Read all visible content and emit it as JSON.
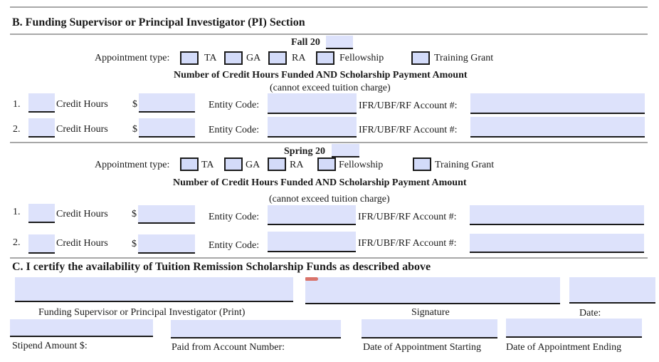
{
  "section_b": {
    "title": "B.  Funding Supervisor or Principal Investigator (PI) Section",
    "fall": {
      "term_label": "Fall 20",
      "year_value": "",
      "appointment_label": "Appointment type:",
      "options": [
        "TA",
        "GA",
        "RA",
        "Fellowship",
        "Training Grant"
      ],
      "subheading": "Number of Credit Hours Funded AND Scholarship Payment Amount",
      "note": "(cannot exceed tuition charge)",
      "rows": [
        {
          "num": "1.",
          "credit_label": "Credit Hours",
          "dollar": "$",
          "entity_label": "Entity Code:",
          "account_label": "IFR/UBF/RF  Account  #:",
          "credit_value": "",
          "amount_value": "",
          "entity_value": "",
          "account_value": ""
        },
        {
          "num": "2.",
          "credit_label": "Credit Hours",
          "dollar": "$",
          "entity_label": "Entity Code:",
          "account_label": "IFR/UBF/RF Account  #:",
          "credit_value": "",
          "amount_value": "",
          "entity_value": "",
          "account_value": ""
        }
      ]
    },
    "spring": {
      "term_label": "Spring 20",
      "year_value": "",
      "appointment_label": "Appointment type:",
      "options": [
        "TA",
        "GA",
        "RA",
        "Fellowship",
        "Training Grant"
      ],
      "subheading": "Number of Credit Hours Funded AND Scholarship Payment Amount",
      "note": "(cannot exceed tuition charge)",
      "rows": [
        {
          "num": "1.",
          "credit_label": "Credit Hours",
          "dollar": "$",
          "entity_label": "Entity Code:",
          "account_label": "IFR/UBF/RF Account #:",
          "credit_value": "",
          "amount_value": "",
          "entity_value": "",
          "account_value": ""
        },
        {
          "num": "2.",
          "credit_label": "Credit Hours",
          "dollar": "$",
          "entity_label": "Entity Code:",
          "account_label": "IFR/UBF/RF Account #:",
          "credit_value": "",
          "amount_value": "",
          "entity_value": "",
          "account_value": ""
        }
      ]
    }
  },
  "section_c": {
    "title": "C.  I certify the availability of Tuition Remission Scholarship Funds as described above",
    "labels": {
      "supervisor_print": "Funding Supervisor or Principal Investigator (Print)",
      "signature": "Signature",
      "date": "Date:",
      "stipend": "Stipend Amount $:",
      "paid_from": "Paid from Account Number:",
      "start": "Date of Appointment Starting",
      "end": "Date of Appointment Ending"
    },
    "values": {
      "supervisor_print": "",
      "signature": "",
      "date": "",
      "stipend": "",
      "paid_from": "",
      "start": "",
      "end": ""
    }
  },
  "colors": {
    "field_fill": "#dde2fb",
    "rule": "#a8a8a8",
    "required_marker": "#d9736a"
  }
}
